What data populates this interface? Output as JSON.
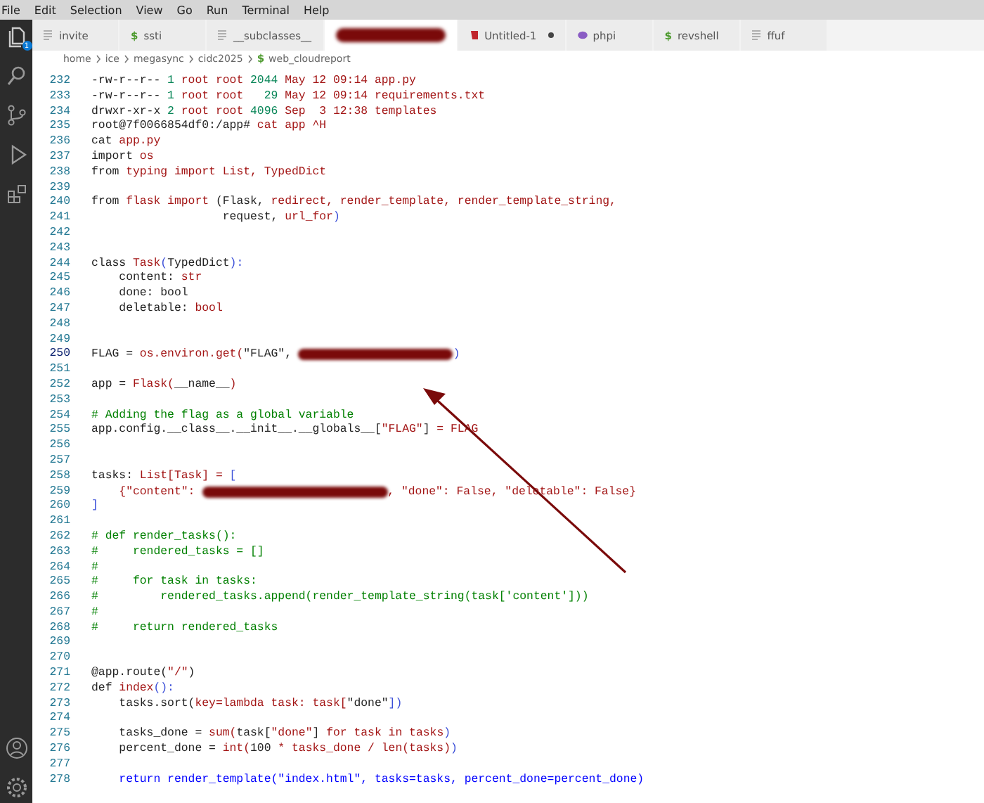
{
  "menu": [
    "File",
    "Edit",
    "Selection",
    "View",
    "Go",
    "Run",
    "Terminal",
    "Help"
  ],
  "activity": {
    "badge": "1"
  },
  "tabs": [
    {
      "label": "invite",
      "kind": "text",
      "selected": false,
      "modified": false
    },
    {
      "label": "ssti",
      "kind": "shell",
      "glyph": "$",
      "selected": false,
      "modified": false
    },
    {
      "label": "__subclasses__",
      "kind": "text",
      "selected": false,
      "modified": false
    },
    {
      "kind": "redacted",
      "selected": true,
      "modified": false
    },
    {
      "label": "Untitled-1",
      "kind": "ruby",
      "selected": false,
      "modified": true
    },
    {
      "label": "phpi",
      "kind": "php",
      "selected": false,
      "modified": false
    },
    {
      "label": "revshell",
      "kind": "shell",
      "glyph": "$",
      "selected": false,
      "modified": false
    },
    {
      "label": "ffuf",
      "kind": "text",
      "selected": false,
      "modified": false
    }
  ],
  "breadcrumb": [
    {
      "label": "home"
    },
    {
      "label": "ice"
    },
    {
      "label": "megasync"
    },
    {
      "label": "cidc2025"
    },
    {
      "label": "web_cloudreport",
      "glyph": "$"
    }
  ],
  "editor": {
    "lines": [
      {
        "number": "232",
        "current": false,
        "tokens": [
          {
            "kind": "plain",
            "text": "-rw-r--r-- "
          },
          {
            "kind": "number",
            "text": "1"
          },
          {
            "kind": "word",
            "text": " root root "
          },
          {
            "kind": "number",
            "text": "2044"
          },
          {
            "kind": "word",
            "text": " May 12 09:14 app.py"
          }
        ]
      },
      {
        "number": "233",
        "current": false,
        "tokens": [
          {
            "kind": "plain",
            "text": "-rw-r--r-- "
          },
          {
            "kind": "number",
            "text": "1"
          },
          {
            "kind": "word",
            "text": " root root   "
          },
          {
            "kind": "number",
            "text": "29"
          },
          {
            "kind": "word",
            "text": " May 12 09:14 requirements.txt"
          }
        ]
      },
      {
        "number": "234",
        "current": false,
        "tokens": [
          {
            "kind": "plain",
            "text": "drwxr-xr-x "
          },
          {
            "kind": "number",
            "text": "2"
          },
          {
            "kind": "word",
            "text": " root root "
          },
          {
            "kind": "number",
            "text": "4096"
          },
          {
            "kind": "word",
            "text": " Sep  3 12:38 templates"
          }
        ]
      },
      {
        "number": "235",
        "current": false,
        "tokens": [
          {
            "kind": "plain",
            "text": "root@7f0066854df0:/app# "
          },
          {
            "kind": "word",
            "text": "cat app ^H"
          }
        ]
      },
      {
        "number": "236",
        "current": false,
        "tokens": [
          {
            "kind": "plain",
            "text": "cat "
          },
          {
            "kind": "word",
            "text": "app.py"
          }
        ]
      },
      {
        "number": "237",
        "current": false,
        "tokens": [
          {
            "kind": "plain",
            "text": "import "
          },
          {
            "kind": "word",
            "text": "os"
          }
        ]
      },
      {
        "number": "238",
        "current": false,
        "tokens": [
          {
            "kind": "plain",
            "text": "from "
          },
          {
            "kind": "word",
            "text": "typing import List, TypedDict"
          }
        ]
      },
      {
        "number": "239",
        "current": false
      },
      {
        "number": "240",
        "current": false,
        "tokens": [
          {
            "kind": "plain",
            "text": "from "
          },
          {
            "kind": "word",
            "text": "flask import "
          },
          {
            "kind": "plain",
            "text": "(Flask, "
          },
          {
            "kind": "word",
            "text": "redirect, render_template, render_template_string,"
          }
        ]
      },
      {
        "number": "241",
        "current": false,
        "tokens": [
          {
            "kind": "plain",
            "text": "                   request, "
          },
          {
            "kind": "word",
            "text": "url_for"
          },
          {
            "kind": "bracket",
            "text": ")"
          }
        ]
      },
      {
        "number": "242",
        "current": false
      },
      {
        "number": "243",
        "current": false
      },
      {
        "number": "244",
        "current": false,
        "tokens": [
          {
            "kind": "plain",
            "text": "class "
          },
          {
            "kind": "word",
            "text": "Task"
          },
          {
            "kind": "bracket",
            "text": "("
          },
          {
            "kind": "plain",
            "text": "TypedDict"
          },
          {
            "kind": "bracket",
            "text": "):"
          }
        ]
      },
      {
        "number": "245",
        "current": false,
        "tokens": [
          {
            "kind": "plain",
            "text": "    content: "
          },
          {
            "kind": "word",
            "text": "str"
          }
        ]
      },
      {
        "number": "246",
        "current": false,
        "tokens": [
          {
            "kind": "plain",
            "text": "    done: bool"
          }
        ]
      },
      {
        "number": "247",
        "current": false,
        "tokens": [
          {
            "kind": "plain",
            "text": "    deletable: "
          },
          {
            "kind": "word",
            "text": "bool"
          }
        ]
      },
      {
        "number": "248",
        "current": false
      },
      {
        "number": "249",
        "current": false
      },
      {
        "number": "250",
        "current": true,
        "tokens": [
          {
            "kind": "plain",
            "text": "FLAG = "
          },
          {
            "kind": "word",
            "text": "os.environ.get("
          },
          {
            "kind": "plain",
            "text": "\"FLAG\", "
          },
          {
            "kind": "redaction"
          },
          {
            "kind": "bracket",
            "text": ")"
          }
        ]
      },
      {
        "number": "251",
        "current": false
      },
      {
        "number": "252",
        "current": false,
        "tokens": [
          {
            "kind": "plain",
            "text": "app = "
          },
          {
            "kind": "word",
            "text": "Flask("
          },
          {
            "kind": "plain",
            "text": "__name__"
          },
          {
            "kind": "word",
            "text": ")"
          }
        ]
      },
      {
        "number": "253",
        "current": false
      },
      {
        "number": "254",
        "current": false,
        "tokens": [
          {
            "kind": "comment",
            "text": "# Adding the flag as a global variable"
          }
        ]
      },
      {
        "number": "255",
        "current": false,
        "tokens": [
          {
            "kind": "plain",
            "text": "app.config.__class__.__init__.__globals__["
          },
          {
            "kind": "word",
            "text": "\"FLAG\""
          },
          {
            "kind": "plain",
            "text": "] "
          },
          {
            "kind": "word",
            "text": "= FLAG"
          }
        ]
      },
      {
        "number": "256",
        "current": false
      },
      {
        "number": "257",
        "current": false
      },
      {
        "number": "258",
        "current": false,
        "tokens": [
          {
            "kind": "plain",
            "text": "tasks: "
          },
          {
            "kind": "word",
            "text": "List[Task] = "
          },
          {
            "kind": "bracket",
            "text": "["
          }
        ]
      },
      {
        "number": "259",
        "current": false,
        "tokens": [
          {
            "kind": "word",
            "text": "    {\"content\": "
          },
          {
            "kind": "redaction"
          },
          {
            "kind": "word",
            "text": ", \"done\": False, \"deletable\": False}"
          }
        ]
      },
      {
        "number": "260",
        "current": false,
        "tokens": [
          {
            "kind": "bracket",
            "text": "]"
          }
        ]
      },
      {
        "number": "261",
        "current": false
      },
      {
        "number": "262",
        "current": false,
        "tokens": [
          {
            "kind": "comment",
            "text": "# def render_tasks():"
          }
        ]
      },
      {
        "number": "263",
        "current": false,
        "tokens": [
          {
            "kind": "comment",
            "text": "#     rendered_tasks = []"
          }
        ]
      },
      {
        "number": "264",
        "current": false,
        "tokens": [
          {
            "kind": "comment",
            "text": "#"
          }
        ]
      },
      {
        "number": "265",
        "current": false,
        "tokens": [
          {
            "kind": "comment",
            "text": "#     for task in tasks:"
          }
        ]
      },
      {
        "number": "266",
        "current": false,
        "tokens": [
          {
            "kind": "comment",
            "text": "#         rendered_tasks.append(render_template_string(task['content']))"
          }
        ]
      },
      {
        "number": "267",
        "current": false,
        "tokens": [
          {
            "kind": "comment",
            "text": "#"
          }
        ]
      },
      {
        "number": "268",
        "current": false,
        "tokens": [
          {
            "kind": "comment",
            "text": "#     return rendered_tasks"
          }
        ]
      },
      {
        "number": "269",
        "current": false
      },
      {
        "number": "270",
        "current": false
      },
      {
        "number": "271",
        "current": false,
        "tokens": [
          {
            "kind": "plain",
            "text": "@app.route("
          },
          {
            "kind": "word",
            "text": "\"/\""
          },
          {
            "kind": "plain",
            "text": ")"
          }
        ]
      },
      {
        "number": "272",
        "current": false,
        "tokens": [
          {
            "kind": "plain",
            "text": "def "
          },
          {
            "kind": "word",
            "text": "index"
          },
          {
            "kind": "bracket",
            "text": "():"
          }
        ]
      },
      {
        "number": "273",
        "current": false,
        "tokens": [
          {
            "kind": "plain",
            "text": "    tasks.sort("
          },
          {
            "kind": "word",
            "text": "key=lambda task: task["
          },
          {
            "kind": "plain",
            "text": "\"done\""
          },
          {
            "kind": "bracket",
            "text": "])"
          }
        ]
      },
      {
        "number": "274",
        "current": false
      },
      {
        "number": "275",
        "current": false,
        "tokens": [
          {
            "kind": "plain",
            "text": "    tasks_done = "
          },
          {
            "kind": "word",
            "text": "sum("
          },
          {
            "kind": "plain",
            "text": "task["
          },
          {
            "kind": "word",
            "text": "\"done\""
          },
          {
            "kind": "plain",
            "text": "] "
          },
          {
            "kind": "word",
            "text": "for task in tasks"
          },
          {
            "kind": "bracket",
            "text": ")"
          }
        ]
      },
      {
        "number": "276",
        "current": false,
        "tokens": [
          {
            "kind": "plain",
            "text": "    percent_done = "
          },
          {
            "kind": "word",
            "text": "int("
          },
          {
            "kind": "plain",
            "text": "100 "
          },
          {
            "kind": "word",
            "text": "* tasks_done / len(tasks)"
          },
          {
            "kind": "bracket",
            "text": ")"
          }
        ]
      },
      {
        "number": "277",
        "current": false
      },
      {
        "number": "278",
        "current": false,
        "tokens": [
          {
            "kind": "keyword",
            "text": "    return render_template(\"index.html\", tasks=tasks, percent_done=percent_done)"
          }
        ]
      }
    ]
  }
}
